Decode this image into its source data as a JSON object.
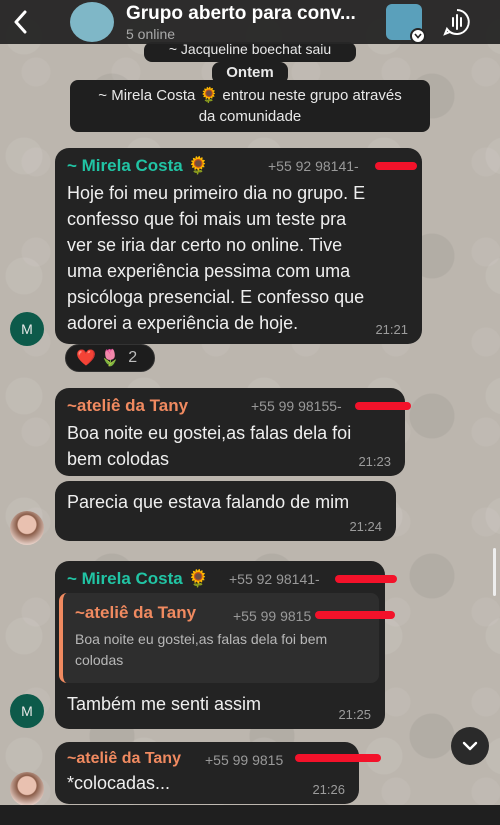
{
  "header": {
    "title": "Grupo aberto para conv...",
    "subtitle": "5 online"
  },
  "system": {
    "left_notice": "~ Jacqueline boechat saiu",
    "date_chip": "Ontem",
    "join_notice_line1": "~ Mirela Costa 🌻 entrou neste grupo através",
    "join_notice_line2": "da comunidade"
  },
  "messages": [
    {
      "sender": "~ Mirela Costa 🌻",
      "phone": "+55 92 98141-",
      "lines": [
        "Hoje foi meu primeiro dia no grupo. E",
        "confesso que foi mais um teste pra",
        "ver se iria dar certo no online. Tive",
        "uma experiência pessima com uma",
        "psicóloga presencial. E confesso que",
        "adorei a experiência de hoje."
      ],
      "time": "21:21",
      "avatar_letter": "M",
      "reactions": "❤️ 🌷",
      "reaction_count": "2"
    },
    {
      "sender": "~ateliê da Tany",
      "phone": "+55 99 98155-",
      "lines": [
        "Boa noite eu gostei,as falas dela foi",
        "bem colodas"
      ],
      "time": "21:23"
    },
    {
      "lines": [
        "Parecia que estava falando de mim"
      ],
      "time": "21:24"
    },
    {
      "sender": "~ Mirela Costa 🌻",
      "phone": "+55 92 98141-",
      "quote_sender": "~ateliê da Tany",
      "quote_phone": "+55 99 9815",
      "quote_lines": [
        "Boa noite eu gostei,as falas dela foi bem",
        "colodas"
      ],
      "text": "Também me senti assim",
      "time": "21:25",
      "avatar_letter": "M"
    },
    {
      "sender": "~ateliê da Tany",
      "phone": "+55 99 9815",
      "text": "*colocadas...",
      "time": "21:26"
    }
  ],
  "colors": {
    "accent_teal": "#21c4a4",
    "accent_orange": "#f08a60",
    "redaction": "#f3122a"
  }
}
